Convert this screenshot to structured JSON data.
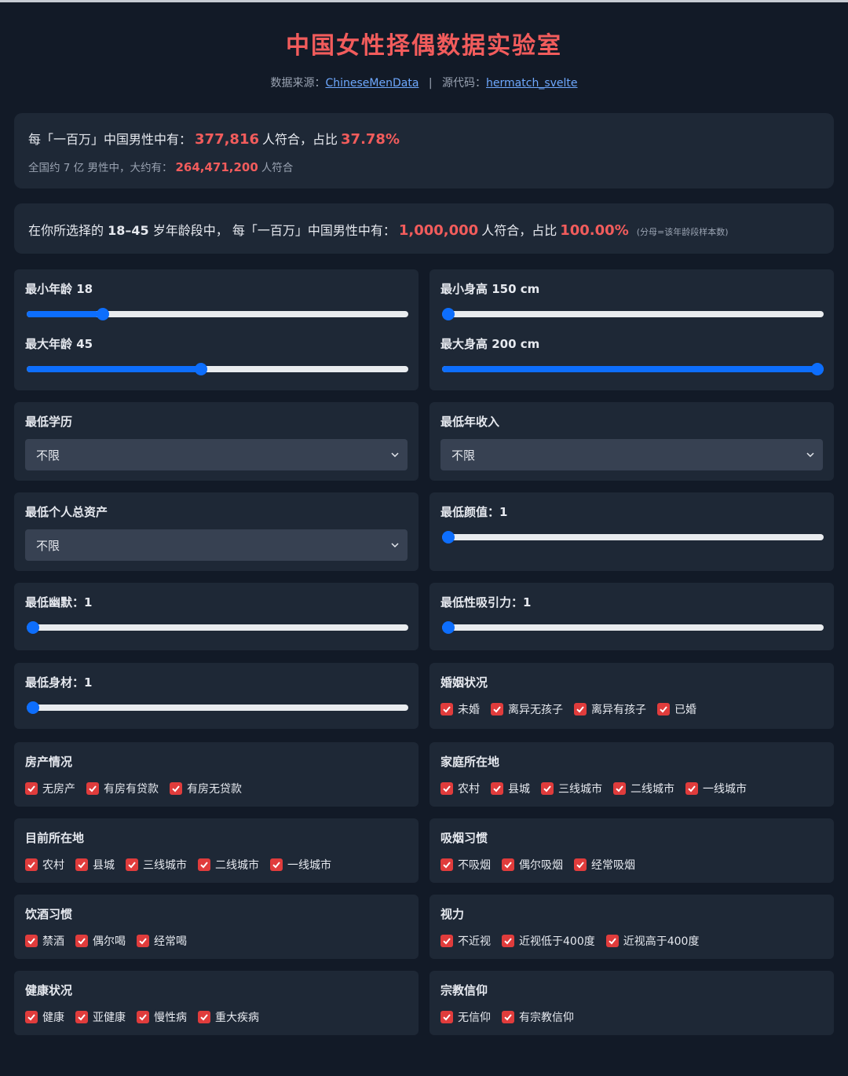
{
  "header": {
    "title": "中国女性择偶数据实验室",
    "source_label": "数据来源：",
    "source_link": "ChineseMenData",
    "sep": "|",
    "code_label": "源代码：",
    "code_link": "hermatch_svelte"
  },
  "summary": {
    "prefix": "每「一百万」中国男性中有：",
    "count": "377,816",
    "mid": "人符合，占比",
    "percent": "37.78%",
    "nat_prefix": "全国约 7 亿 男性中，大约有：",
    "nat_count": "264,471,200",
    "nat_suffix": "人符合"
  },
  "age_summary": {
    "prefix": "在你所选择的",
    "range": "18–45",
    "mid1": "岁年龄段中，",
    "mid2": "每「一百万」中国男性中有：",
    "count": "1,000,000",
    "mid3": "人符合，占比",
    "percent": "100.00%",
    "note": "(分母=该年龄段样本数)"
  },
  "age": {
    "min_label": "最小年龄 18",
    "min_value": 0.19,
    "max_label": "最大年龄 45",
    "max_value": 0.455
  },
  "height": {
    "min_label": "最小身高 150 cm",
    "min_value": 0.0,
    "max_label": "最大身高 200 cm",
    "max_value": 1.0
  },
  "education": {
    "label": "最低学历",
    "value": "不限"
  },
  "income": {
    "label": "最低年收入",
    "value": "不限"
  },
  "assets": {
    "label": "最低个人总资产",
    "value": "不限"
  },
  "looks": {
    "label": "最低颜值：1",
    "value": 0.0
  },
  "humor": {
    "label": "最低幽默：1",
    "value": 0.0
  },
  "attraction": {
    "label": "最低性吸引力：1",
    "value": 0.0
  },
  "figure": {
    "label": "最低身材：1",
    "value": 0.0
  },
  "marital": {
    "label": "婚姻状况",
    "options": [
      "未婚",
      "离异无孩子",
      "离异有孩子",
      "已婚"
    ]
  },
  "property": {
    "label": "房产情况",
    "options": [
      "无房产",
      "有房有贷款",
      "有房无贷款"
    ]
  },
  "hometown": {
    "label": "家庭所在地",
    "options": [
      "农村",
      "县城",
      "三线城市",
      "二线城市",
      "一线城市"
    ]
  },
  "current": {
    "label": "目前所在地",
    "options": [
      "农村",
      "县城",
      "三线城市",
      "二线城市",
      "一线城市"
    ]
  },
  "smoking": {
    "label": "吸烟习惯",
    "options": [
      "不吸烟",
      "偶尔吸烟",
      "经常吸烟"
    ]
  },
  "drinking": {
    "label": "饮酒习惯",
    "options": [
      "禁酒",
      "偶尔喝",
      "经常喝"
    ]
  },
  "vision": {
    "label": "视力",
    "options": [
      "不近视",
      "近视低于400度",
      "近视高于400度"
    ]
  },
  "health": {
    "label": "健康状况",
    "options": [
      "健康",
      "亚健康",
      "慢性病",
      "重大疾病"
    ]
  },
  "religion": {
    "label": "宗教信仰",
    "options": [
      "无信仰",
      "有宗教信仰"
    ]
  },
  "colors": {
    "accent": "#f25c5c",
    "slider": "#0d6efd",
    "checkbox": "#e03c3c"
  }
}
